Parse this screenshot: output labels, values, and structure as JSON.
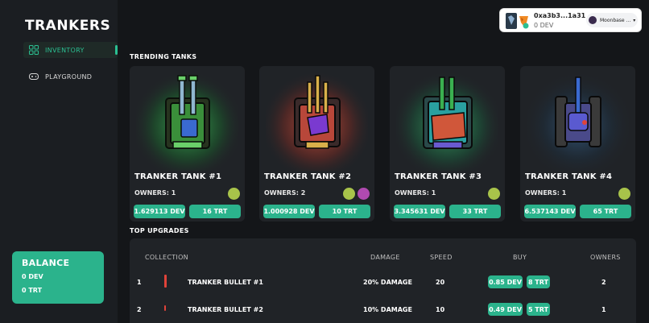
{
  "app": {
    "title": "TRANKERS"
  },
  "sidebar": {
    "items": [
      {
        "label": "INVENTORY",
        "icon": "grid-icon",
        "active": true
      },
      {
        "label": "PLAYGROUND",
        "icon": "gamepad-icon",
        "active": false
      }
    ]
  },
  "balance": {
    "title": "BALANCE",
    "dev": "0 DEV",
    "trt": "0 TRT"
  },
  "wallet": {
    "address": "0xa3b3...1a31",
    "balance": "0 DEV",
    "network": "Moonbase ..."
  },
  "trending": {
    "title": "TRENDING TANKS",
    "cards": [
      {
        "name": "TRANKER TANK #1",
        "owners": "OWNERS: 1",
        "dev": "1.629113 DEV",
        "trt": "16 TRT",
        "glow": "#2e9a46"
      },
      {
        "name": "TRANKER TANK #2",
        "owners": "OWNERS: 2",
        "dev": "1.000928 DEV",
        "trt": "10 TRT",
        "glow": "#c24a3a"
      },
      {
        "name": "TRANKER TANK #3",
        "owners": "OWNERS: 1",
        "dev": "3.345631 DEV",
        "trt": "33 TRT",
        "glow": "#2aa060"
      },
      {
        "name": "TRANKER TANK #4",
        "owners": "OWNERS: 1",
        "dev": "6.537143 DEV",
        "trt": "65 TRT",
        "glow": "#2a4a6a"
      }
    ]
  },
  "upgrades": {
    "title": "TOP UPGRADES",
    "headers": {
      "collection": "COLLECTION",
      "damage": "DAMAGE",
      "speed": "SPEED",
      "buy": "BUY",
      "owners": "OWNERS"
    },
    "rows": [
      {
        "rank": "1",
        "name": "TRANKER BULLET #1",
        "damage": "20% DAMAGE",
        "speed": "20",
        "dev": "0.85 DEV",
        "trt": "8 TRT",
        "owners": "2"
      },
      {
        "rank": "2",
        "name": "TRANKER BULLET #2",
        "damage": "10% DAMAGE",
        "speed": "10",
        "dev": "0.49 DEV",
        "trt": "5 TRT",
        "owners": "1"
      }
    ]
  },
  "colors": {
    "accent": "#2bb38c",
    "background": "#141619",
    "panel": "#202327"
  }
}
